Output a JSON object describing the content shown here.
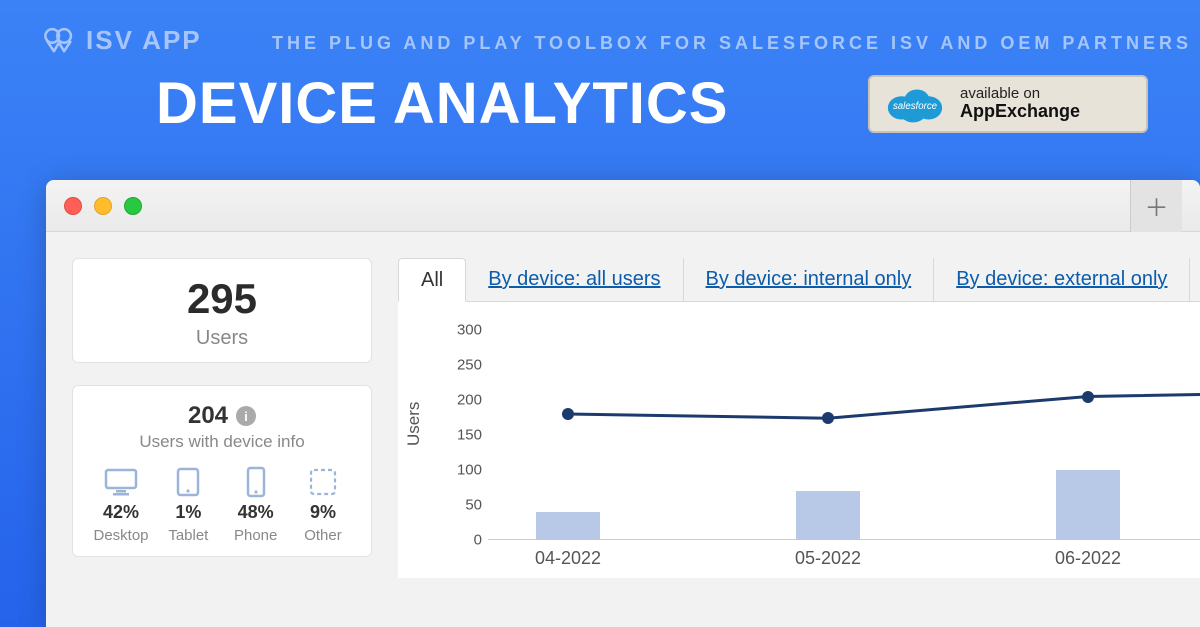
{
  "header": {
    "logo_text": "ISV APP",
    "tagline": "THE PLUG AND PLAY TOOLBOX FOR SALESFORCE ISV AND OEM PARTNERS",
    "title": "DEVICE ANALYTICS",
    "badge": {
      "cloud_text": "salesforce",
      "line1": "available on",
      "line2": "AppExchange"
    }
  },
  "summary": {
    "total_users": "295",
    "total_users_label": "Users",
    "with_info": "204",
    "with_info_label": "Users with device info",
    "devices": [
      {
        "name": "Desktop",
        "pct": "42%",
        "icon": "desktop-icon"
      },
      {
        "name": "Tablet",
        "pct": "1%",
        "icon": "tablet-icon"
      },
      {
        "name": "Phone",
        "pct": "48%",
        "icon": "phone-icon"
      },
      {
        "name": "Other",
        "pct": "9%",
        "icon": "other-icon"
      }
    ]
  },
  "tabs": [
    {
      "label": "All",
      "active": true
    },
    {
      "label": "By device: all users",
      "active": false
    },
    {
      "label": "By device: internal only",
      "active": false
    },
    {
      "label": "By device: external only",
      "active": false
    }
  ],
  "chart_data": {
    "type": "bar-line",
    "ylabel": "Users",
    "ylim": [
      0,
      300
    ],
    "yticks": [
      0,
      50,
      100,
      150,
      200,
      250,
      300
    ],
    "categories": [
      "04-2022",
      "05-2022",
      "06-2022"
    ],
    "series": [
      {
        "name": "bars",
        "type": "bar",
        "values": [
          40,
          70,
          100
        ]
      },
      {
        "name": "line",
        "type": "line",
        "values": [
          180,
          174,
          205
        ]
      }
    ]
  }
}
